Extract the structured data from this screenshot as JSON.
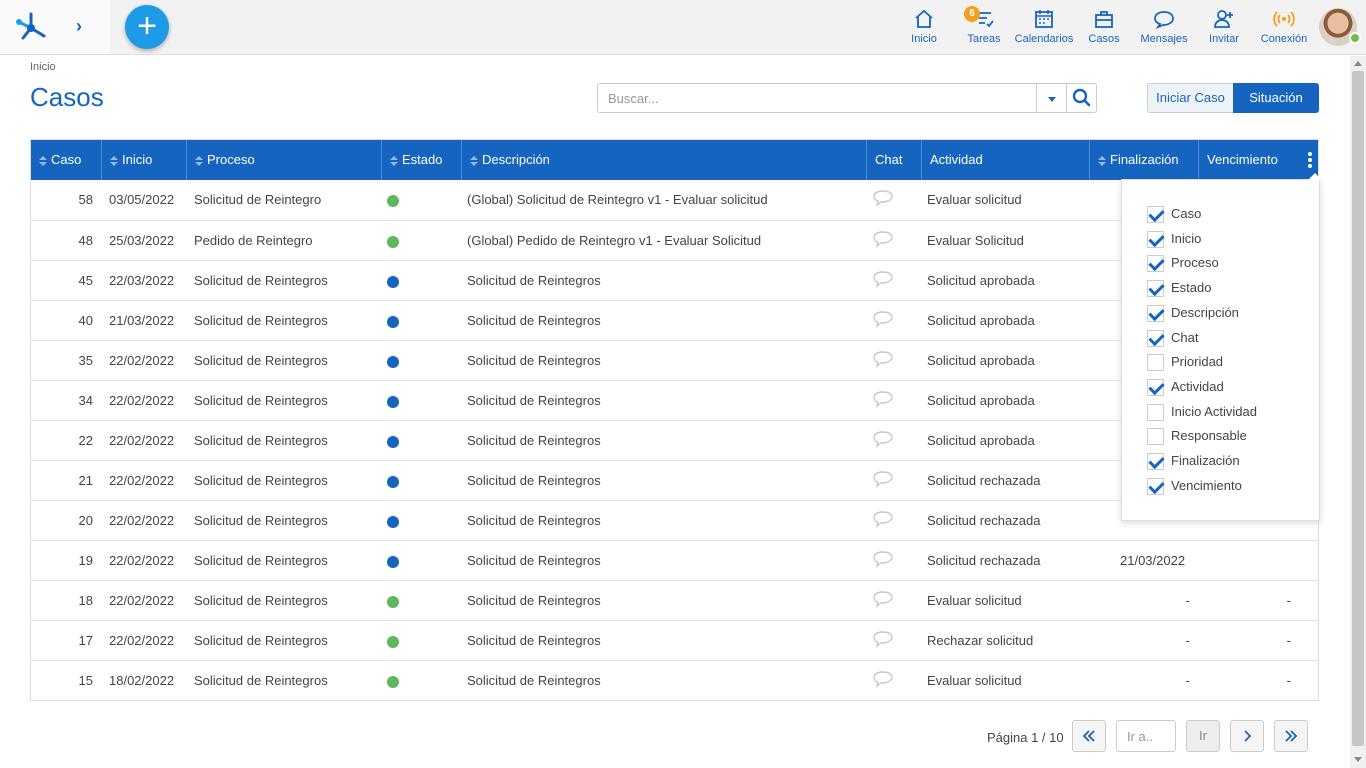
{
  "nav": {
    "items": [
      {
        "label": "Inicio",
        "icon": "home-icon"
      },
      {
        "label": "Tareas",
        "icon": "tasks-icon",
        "badge": "6"
      },
      {
        "label": "Calendarios",
        "icon": "calendar-icon"
      },
      {
        "label": "Casos",
        "icon": "briefcase-icon"
      },
      {
        "label": "Mensajes",
        "icon": "chat-bubble-icon"
      },
      {
        "label": "Invitar",
        "icon": "add-user-icon"
      },
      {
        "label": "Conexión",
        "icon": "connection-icon"
      }
    ]
  },
  "colors": {
    "primary": "#1565c0",
    "accent": "#1e9be6",
    "green": "#5cb85c",
    "blue_dot": "#1565c0",
    "badge": "#f0a020"
  },
  "header": {
    "breadcrumb": "Inicio",
    "title": "Casos",
    "search_placeholder": "Buscar...",
    "btn_iniciar": "Iniciar Caso",
    "btn_situacion": "Situación"
  },
  "table": {
    "columns": [
      "Caso",
      "Inicio",
      "Proceso",
      "Estado",
      "Descripción",
      "Chat",
      "Actividad",
      "Finalización",
      "Vencimiento"
    ],
    "rows": [
      {
        "caso": "58",
        "inicio": "03/05/2022",
        "proceso": "Solicitud de Reintegro",
        "estado": "green",
        "descripcion": "(Global) Solicitud de Reintegro v1 - Evaluar solicitud",
        "actividad": "Evaluar solicitud",
        "finalizacion": "",
        "vencimiento": ""
      },
      {
        "caso": "48",
        "inicio": "25/03/2022",
        "proceso": "Pedido de Reintegro",
        "estado": "green",
        "descripcion": "(Global) Pedido de Reintegro v1 - Evaluar Solicitud",
        "actividad": "Evaluar Solicitud",
        "finalizacion": "",
        "vencimiento": ""
      },
      {
        "caso": "45",
        "inicio": "22/03/2022",
        "proceso": "Solicitud de Reintegros",
        "estado": "blue",
        "descripcion": "Solicitud de Reintegros",
        "actividad": "Solicitud aprobada",
        "finalizacion": "",
        "vencimiento": ""
      },
      {
        "caso": "40",
        "inicio": "21/03/2022",
        "proceso": "Solicitud de Reintegros",
        "estado": "blue",
        "descripcion": "Solicitud de Reintegros",
        "actividad": "Solicitud aprobada",
        "finalizacion": "",
        "vencimiento": ""
      },
      {
        "caso": "35",
        "inicio": "22/02/2022",
        "proceso": "Solicitud de Reintegros",
        "estado": "blue",
        "descripcion": "Solicitud de Reintegros",
        "actividad": "Solicitud aprobada",
        "finalizacion": "",
        "vencimiento": ""
      },
      {
        "caso": "34",
        "inicio": "22/02/2022",
        "proceso": "Solicitud de Reintegros",
        "estado": "blue",
        "descripcion": "Solicitud de Reintegros",
        "actividad": "Solicitud aprobada",
        "finalizacion": "",
        "vencimiento": ""
      },
      {
        "caso": "22",
        "inicio": "22/02/2022",
        "proceso": "Solicitud de Reintegros",
        "estado": "blue",
        "descripcion": "Solicitud de Reintegros",
        "actividad": "Solicitud aprobada",
        "finalizacion": "",
        "vencimiento": ""
      },
      {
        "caso": "21",
        "inicio": "22/02/2022",
        "proceso": "Solicitud de Reintegros",
        "estado": "blue",
        "descripcion": "Solicitud de Reintegros",
        "actividad": "Solicitud rechazada",
        "finalizacion": "",
        "vencimiento": ""
      },
      {
        "caso": "20",
        "inicio": "22/02/2022",
        "proceso": "Solicitud de Reintegros",
        "estado": "blue",
        "descripcion": "Solicitud de Reintegros",
        "actividad": "Solicitud rechazada",
        "finalizacion": "",
        "vencimiento": ""
      },
      {
        "caso": "19",
        "inicio": "22/02/2022",
        "proceso": "Solicitud de Reintegros",
        "estado": "blue",
        "descripcion": "Solicitud de Reintegros",
        "actividad": "Solicitud rechazada",
        "finalizacion": "21/03/2022",
        "vencimiento": ""
      },
      {
        "caso": "18",
        "inicio": "22/02/2022",
        "proceso": "Solicitud de Reintegros",
        "estado": "green",
        "descripcion": "Solicitud de Reintegros",
        "actividad": "Evaluar solicitud",
        "finalizacion": "-",
        "vencimiento": "-"
      },
      {
        "caso": "17",
        "inicio": "22/02/2022",
        "proceso": "Solicitud de Reintegros",
        "estado": "green",
        "descripcion": "Solicitud de Reintegros",
        "actividad": "Rechazar solicitud",
        "finalizacion": "-",
        "vencimiento": "-"
      },
      {
        "caso": "15",
        "inicio": "18/02/2022",
        "proceso": "Solicitud de Reintegros",
        "estado": "green",
        "descripcion": "Solicitud de Reintegros",
        "actividad": "Evaluar solicitud",
        "finalizacion": "-",
        "vencimiento": "-"
      }
    ]
  },
  "column_chooser": {
    "options": [
      {
        "label": "Caso",
        "checked": true
      },
      {
        "label": "Inicio",
        "checked": true
      },
      {
        "label": "Proceso",
        "checked": true
      },
      {
        "label": "Estado",
        "checked": true
      },
      {
        "label": "Descripción",
        "checked": true
      },
      {
        "label": "Chat",
        "checked": true
      },
      {
        "label": "Prioridad",
        "checked": false
      },
      {
        "label": "Actividad",
        "checked": true
      },
      {
        "label": "Inicio Actividad",
        "checked": false
      },
      {
        "label": "Responsable",
        "checked": false
      },
      {
        "label": "Finalización",
        "checked": true
      },
      {
        "label": "Vencimiento",
        "checked": true
      }
    ]
  },
  "pagination": {
    "page_info": "Página 1 / 10",
    "goto_placeholder": "Ir a..",
    "go_label": "Ir"
  }
}
